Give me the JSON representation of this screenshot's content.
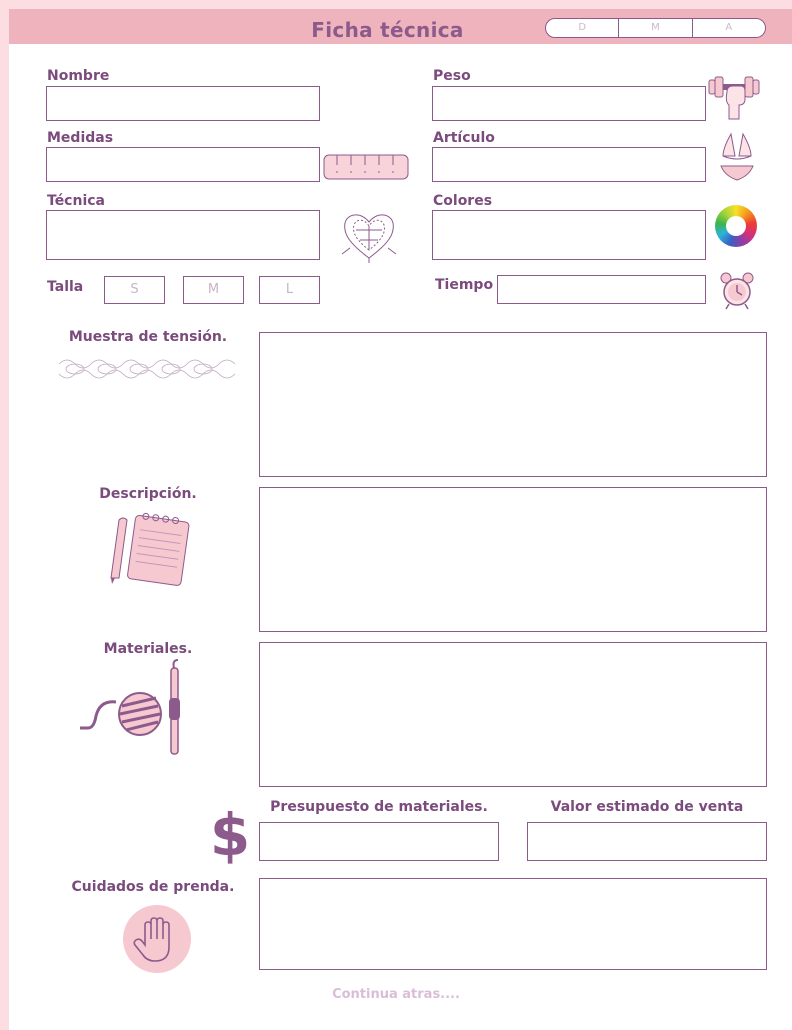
{
  "header": {
    "title": "Ficha técnica",
    "date_fields": [
      "D",
      "M",
      "A"
    ]
  },
  "fields": {
    "nombre": "Nombre",
    "peso": "Peso",
    "medidas": "Medidas",
    "articulo": "Artículo",
    "tecnica": "Técnica",
    "colores": "Colores",
    "talla": "Talla",
    "tiempo": "Tiempo"
  },
  "sizes": [
    "S",
    "M",
    "L"
  ],
  "sections": {
    "muestra": "Muestra de tensión.",
    "descripcion": "Descripción.",
    "materiales": "Materiales.",
    "presupuesto": "Presupuesto de materiales.",
    "valor": "Valor estimado de venta",
    "cuidados": "Cuidados de prenda."
  },
  "footer": "Continua atras....",
  "colors": {
    "accent": "#8d5a8c",
    "label": "#7a4b7c",
    "band": "#eeb3bd",
    "pink_bg": "#fbdde2"
  },
  "icons": [
    "dumbbell-icon",
    "ruler-icon",
    "bikini-icon",
    "crochet-heart-icon",
    "color-wheel-icon",
    "alarm-clock-icon",
    "braid-swatch-icon",
    "pencil-notepad-icon",
    "yarn-hook-icon",
    "dollar-icon",
    "hand-icon"
  ]
}
